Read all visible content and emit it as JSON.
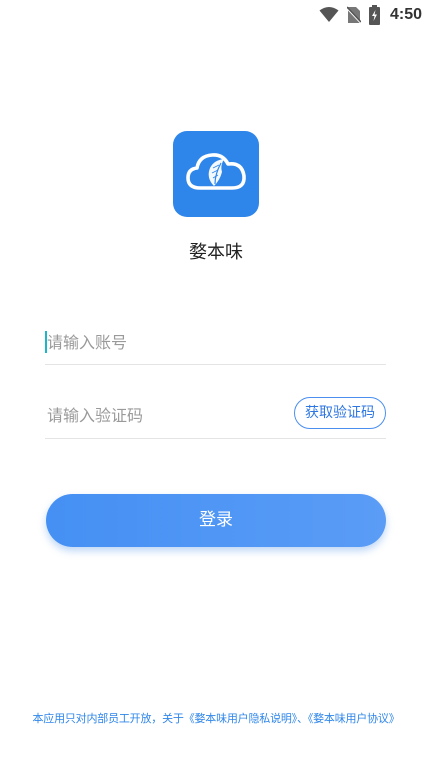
{
  "status_bar": {
    "time": "4:50",
    "icons": [
      "wifi-icon",
      "no-sim-icon",
      "battery-charging-icon"
    ]
  },
  "app": {
    "logo_icon": "cloud-feather-icon",
    "name": "婺本味",
    "accent_color": "#2f86ea"
  },
  "form": {
    "account_placeholder": "请输入账号",
    "account_value": "",
    "code_placeholder": "请输入验证码",
    "code_value": "",
    "get_code_label": "获取验证码",
    "login_label": "登录"
  },
  "footer": {
    "prefix": "本应用只对内部员工开放，关于",
    "privacy_link": "《婺本味用户隐私说明》",
    "separator": "、",
    "agreement_link": "《婺本味用户协议》"
  }
}
